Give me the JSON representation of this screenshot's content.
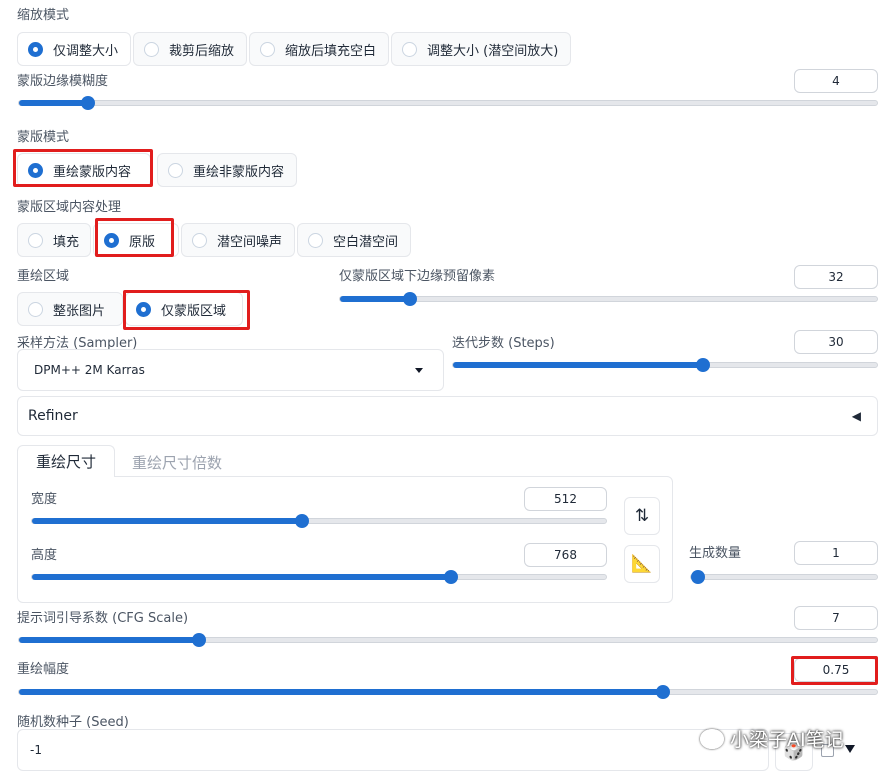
{
  "resize_mode": {
    "label": "缩放模式",
    "options": [
      "仅调整大小",
      "裁剪后缩放",
      "缩放后填充空白",
      "调整大小 (潜空间放大)"
    ],
    "selected": 0
  },
  "mask_blur": {
    "label": "蒙版边缘模糊度",
    "value": "4",
    "fraction": 0.08
  },
  "mask_mode": {
    "label": "蒙版模式",
    "options": [
      "重绘蒙版内容",
      "重绘非蒙版内容"
    ],
    "selected": 0
  },
  "masked_content": {
    "label": "蒙版区域内容处理",
    "options": [
      "填充",
      "原版",
      "潜空间噪声",
      "空白潜空间"
    ],
    "selected": 1
  },
  "inpaint_area": {
    "label": "重绘区域",
    "options": [
      "整张图片",
      "仅蒙版区域"
    ],
    "selected": 1
  },
  "only_masked_padding": {
    "label": "仅蒙版区域下边缘预留像素",
    "value": "32",
    "fraction": 0.13
  },
  "sampler": {
    "label": "采样方法 (Sampler)",
    "value": "DPM++ 2M Karras"
  },
  "steps": {
    "label": "迭代步数 (Steps)",
    "value": "30",
    "fraction": 0.59
  },
  "refiner": {
    "label": "Refiner",
    "toggle_glyph": "◀"
  },
  "size_tabs": {
    "tabs": [
      "重绘尺寸",
      "重绘尺寸倍数"
    ],
    "active": 0
  },
  "width": {
    "label": "宽度",
    "value": "512",
    "fraction": 0.47
  },
  "height": {
    "label": "高度",
    "value": "768",
    "fraction": 0.73
  },
  "swap_icon_glyph": "⇅",
  "ratio_icon_glyph": "📐",
  "batch_count": {
    "label": "生成数量",
    "value": "1",
    "fraction": 0.0
  },
  "cfg_scale": {
    "label": "提示词引导系数 (CFG Scale)",
    "value": "7",
    "fraction": 0.21
  },
  "denoising": {
    "label": "重绘幅度",
    "value": "0.75",
    "fraction": 0.75
  },
  "seed": {
    "label": "随机数种子 (Seed)",
    "value": "-1"
  },
  "dice_glyph": "🎲",
  "watermark": "小梁子AI笔记",
  "colors": {
    "accent": "#1f6fd1",
    "highlight": "#e11d1d"
  }
}
